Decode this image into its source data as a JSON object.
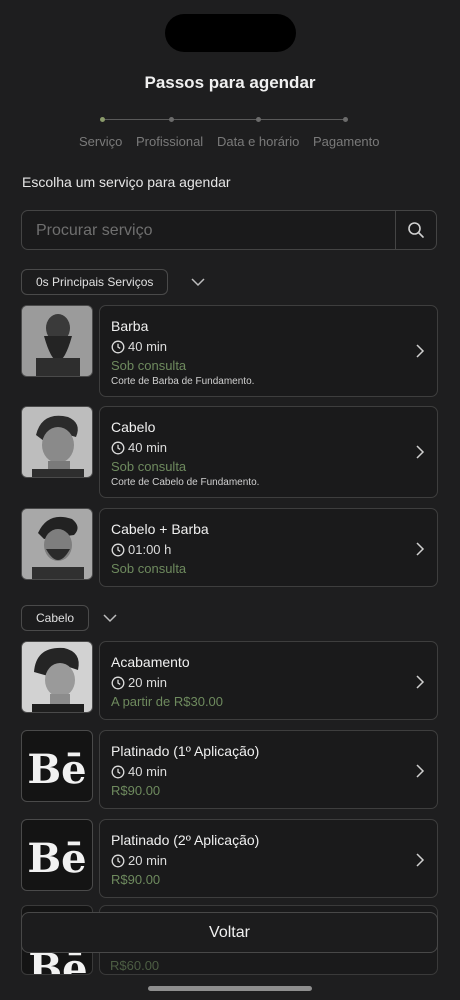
{
  "header": {
    "title": "Passos para agendar"
  },
  "steps": [
    "Serviço",
    "Profissional",
    "Data e horário",
    "Pagamento"
  ],
  "subtitle": "Escolha um serviço para agendar",
  "search": {
    "placeholder": "Procurar serviço"
  },
  "categories": [
    {
      "label": "0s Principais Serviços",
      "services": [
        {
          "name": "Barba",
          "duration": "40 min",
          "price": "Sob consulta",
          "description": "Corte de Barba de Fundamento.",
          "image": "beard-portrait"
        },
        {
          "name": "Cabelo",
          "duration": "40 min",
          "price": "Sob consulta",
          "description": "Corte de Cabelo de Fundamento.",
          "image": "haircut-profile"
        },
        {
          "name": "Cabelo + Barba",
          "duration": "01:00 h",
          "price": "Sob consulta",
          "description": "",
          "image": "hair-beard-portrait"
        }
      ]
    },
    {
      "label": "Cabelo",
      "services": [
        {
          "name": "Acabamento",
          "duration": "20 min",
          "price": "A partir de R$30.00",
          "description": "",
          "image": "curly-haircut-profile"
        },
        {
          "name": "Platinado (1º Aplicação)",
          "duration": "40 min",
          "price": "R$90.00",
          "description": "",
          "image": "be-logo"
        },
        {
          "name": "Platinado (2º Aplicação)",
          "duration": "20 min",
          "price": "R$90.00",
          "description": "",
          "image": "be-logo"
        }
      ]
    }
  ],
  "partial_price": "R$60.00",
  "logo_text": "Bē",
  "footer": {
    "back_label": "Voltar"
  },
  "colors": {
    "background": "#1e1e1f",
    "price_green": "#6e8a5e",
    "step_active": "#8a9a6a"
  }
}
